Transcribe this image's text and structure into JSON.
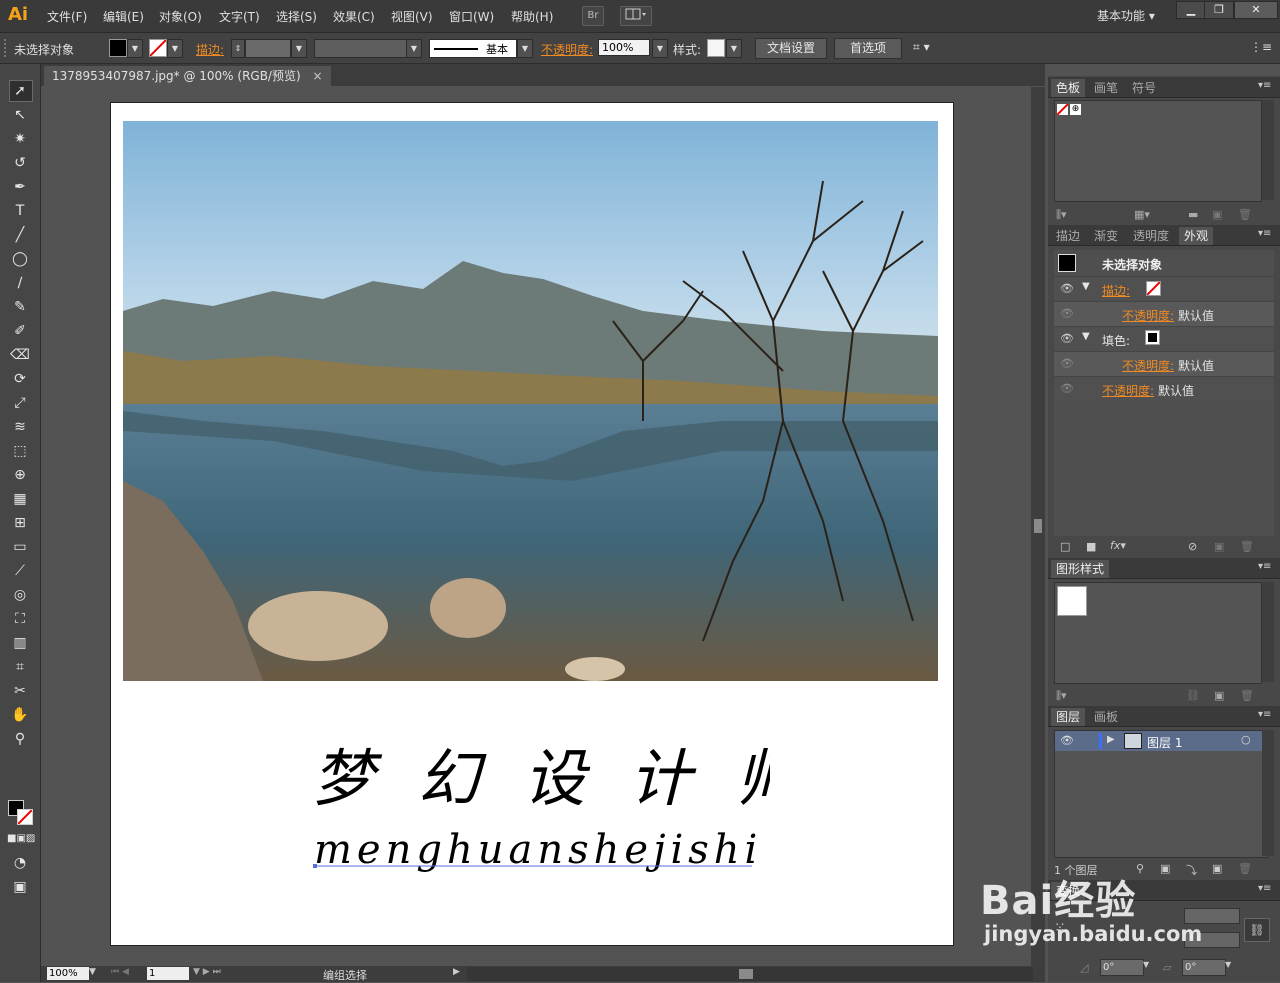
{
  "app": {
    "logo": "Ai",
    "workspace": "基本功能"
  },
  "menu": [
    "文件(F)",
    "编辑(E)",
    "对象(O)",
    "文字(T)",
    "选择(S)",
    "效果(C)",
    "视图(V)",
    "窗口(W)",
    "帮助(H)"
  ],
  "menubar_buttons": {
    "bridge": "Br"
  },
  "control": {
    "selection": "未选择对象",
    "stroke_label": "描边:",
    "style_basic": "基本",
    "opacity_label": "不透明度:",
    "opacity_value": "100%",
    "style_label": "样式:",
    "doc_setup": "文档设置",
    "preferences": "首选项"
  },
  "document": {
    "tab_title": "1378953407987.jpg* @ 100% (RGB/预览)",
    "tab_close": "×",
    "calligraphy_title": "梦 幻 设 计 师",
    "calligraphy_pinyin": "menghuanshejishi"
  },
  "status": {
    "zoom": "100%",
    "artboard": "1",
    "info": "编组选择"
  },
  "panels": {
    "swatches_tabs": [
      "色板",
      "画笔",
      "符号"
    ],
    "appearance_tabs": [
      "描边",
      "渐变",
      "透明度",
      "外观"
    ],
    "appearance": {
      "header": "未选择对象",
      "stroke": "描边:",
      "opacity": "不透明度:",
      "default": "默认值",
      "fill": "填色:"
    },
    "graphic_styles_tab": "图形样式",
    "layers_tabs": [
      "图层",
      "画板"
    ],
    "layer_name": "图层 1",
    "layer_count": "1 个图层",
    "transform_tab": "变换",
    "angle1": "0°",
    "angle2": "0°"
  },
  "watermark": {
    "brand": "Bai经验",
    "url": "jingyan.baidu.com"
  }
}
